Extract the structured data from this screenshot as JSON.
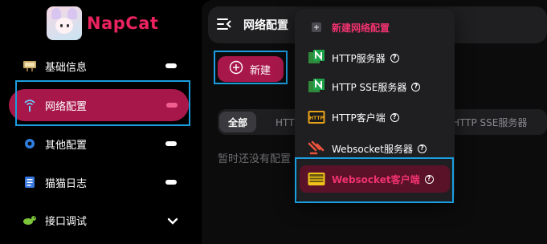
{
  "brand": {
    "name": "NapCat"
  },
  "sidebar": {
    "items": [
      {
        "label": "基础信息",
        "icon": "info-board-icon"
      },
      {
        "label": "网络配置",
        "icon": "network-icon",
        "active": true
      },
      {
        "label": "其他配置",
        "icon": "gear-icon"
      },
      {
        "label": "猫猫日志",
        "icon": "log-icon"
      },
      {
        "label": "接口调试",
        "icon": "bug-icon",
        "expandable": true
      }
    ]
  },
  "header": {
    "title": "网络配置"
  },
  "main": {
    "new_button": "新建",
    "tabs": [
      "全部",
      "HTTP服务器",
      "HTTP SSE服务器"
    ],
    "empty_text": "暂时还没有配置"
  },
  "dropdown": {
    "header": "新建网络配置",
    "items": [
      {
        "label": "HTTP服务器",
        "icon": "http-server-icon"
      },
      {
        "label": "HTTP SSE服务器",
        "icon": "http-sse-icon"
      },
      {
        "label": "HTTP客户端",
        "icon": "http-client-icon"
      },
      {
        "label": "Websocket服务器",
        "icon": "websocket-server-icon"
      },
      {
        "label": "Websocket客户端",
        "icon": "websocket-client-icon",
        "selected": true
      }
    ]
  },
  "colors": {
    "accent": "#a8174a",
    "accent_text": "#f0326f",
    "highlight": "#1a9ee0"
  }
}
